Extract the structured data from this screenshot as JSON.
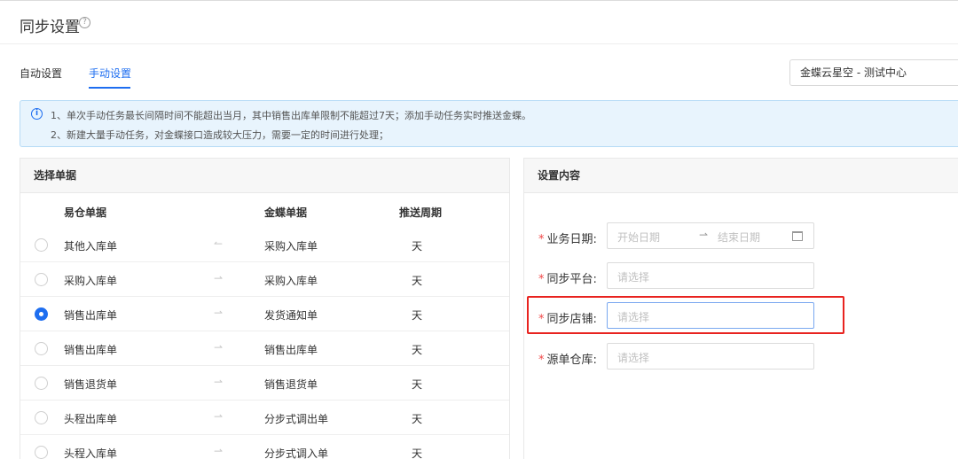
{
  "header": {
    "title": "同步设置",
    "help_icon": "question-circle-icon"
  },
  "tabs": [
    {
      "label": "自动设置",
      "active": false
    },
    {
      "label": "手动设置",
      "active": true
    }
  ],
  "org_select": {
    "value": "金蝶云星空 - 测试中心"
  },
  "notice": {
    "icon": "info-circle-icon",
    "line1": "1、单次手动任务最长间隔时间不能超出当月，其中销售出库单限制不能超过7天；添加手动任务实时推送金蝶。",
    "line2": "2、新建大量手动任务，对金蝶接口造成较大压力，需要一定的时间进行处理；"
  },
  "left_panel": {
    "title": "选择单据",
    "columns": [
      "易仓单据",
      "金蝶单据",
      "推送周期"
    ],
    "rows": [
      {
        "source": "其他入库单",
        "target": "采购入库单",
        "period": "天",
        "arrow": "↼",
        "selected": false
      },
      {
        "source": "采购入库单",
        "target": "采购入库单",
        "period": "天",
        "arrow": "⇀",
        "selected": false
      },
      {
        "source": "销售出库单",
        "target": "发货通知单",
        "period": "天",
        "arrow": "⇀",
        "selected": true
      },
      {
        "source": "销售出库单",
        "target": "销售出库单",
        "period": "天",
        "arrow": "⇀",
        "selected": false
      },
      {
        "source": "销售退货单",
        "target": "销售退货单",
        "period": "天",
        "arrow": "⇀",
        "selected": false
      },
      {
        "source": "头程出库单",
        "target": "分步式调出单",
        "period": "天",
        "arrow": "⇀",
        "selected": false
      },
      {
        "source": "头程入库单",
        "target": "分步式调入单",
        "period": "天",
        "arrow": "⇀",
        "selected": false
      }
    ]
  },
  "right_panel": {
    "title": "设置内容",
    "required_mark": "*",
    "fields": {
      "business_date": {
        "label": "业务日期:",
        "start_placeholder": "开始日期",
        "separator": "⇀",
        "end_placeholder": "结束日期",
        "icon": "calendar-icon"
      },
      "sync_platform": {
        "label": "同步平台:",
        "placeholder": "请选择"
      },
      "sync_store": {
        "label": "同步店铺:",
        "placeholder": "请选择"
      },
      "source_warehouse": {
        "label": "源单仓库:",
        "placeholder": "请选择"
      }
    }
  },
  "colors": {
    "accent": "#1e6ef0",
    "required": "#f04848",
    "highlight": "#e8231f",
    "notice_bg": "#e8f4fd"
  }
}
